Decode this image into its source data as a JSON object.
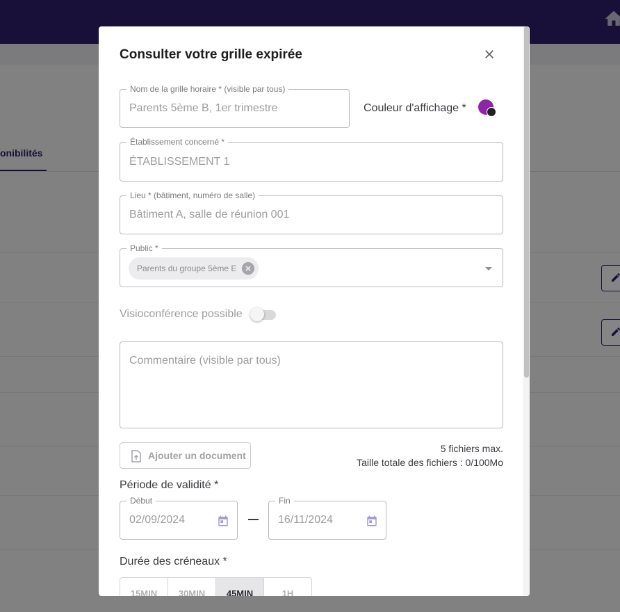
{
  "background": {
    "tab_label": "onibilités"
  },
  "modal": {
    "title": "Consulter votre grille expirée",
    "name_field": {
      "label": "Nom de la grille horaire * (visible par tous)",
      "value": "Parents 5ème B, 1er trimestre"
    },
    "color": {
      "label": "Couleur d'affichage *",
      "value": "#8e24aa"
    },
    "establishment_field": {
      "label": "Établissement concerné *",
      "value": "ÉTABLISSEMENT 1"
    },
    "place_field": {
      "label": "Lieu * (bâtiment, numéro de salle)",
      "value": "Bâtiment A, salle de réunion 001"
    },
    "public_field": {
      "label": "Public *",
      "chip": "Parents du groupe 5ème E"
    },
    "visio": {
      "label": "Visioconférence possible",
      "enabled": false
    },
    "comment": {
      "placeholder": "Commentaire (visible par tous)"
    },
    "documents": {
      "button_label": "Ajouter un document",
      "max_files": "5 fichiers max.",
      "total_size": "Taille totale des fichiers : 0/100Mo"
    },
    "period": {
      "label": "Période de validité *",
      "start": {
        "label": "Début",
        "value": "02/09/2024"
      },
      "end": {
        "label": "Fin",
        "value": "16/11/2024"
      }
    },
    "duration": {
      "label": "Durée des créneaux *",
      "options": [
        "15MIN",
        "30MIN",
        "45MIN",
        "1H"
      ],
      "selected": "45MIN"
    }
  }
}
